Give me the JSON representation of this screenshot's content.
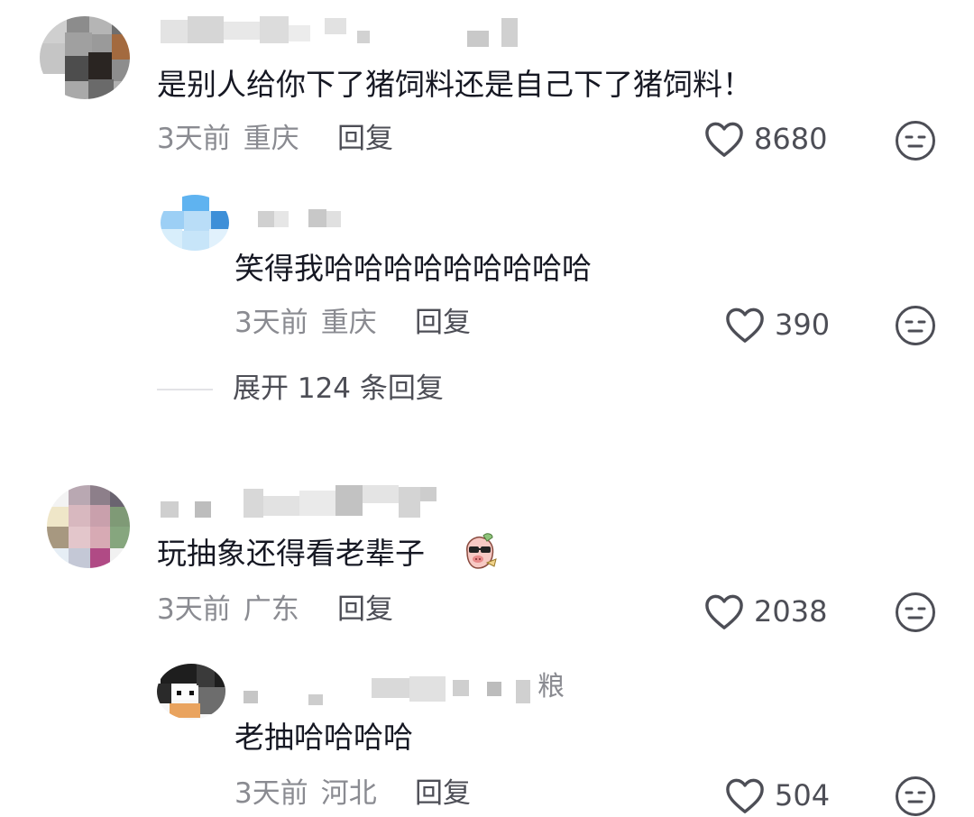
{
  "comments": [
    {
      "text": "是别人给你下了猪饲料还是自己下了猪饲料！",
      "time": "3天前",
      "location": "重庆",
      "reply_label": "回复",
      "likes": "8680",
      "replies": [
        {
          "text": "笑得我哈哈哈哈哈哈哈哈哈",
          "time": "3天前",
          "location": "重庆",
          "reply_label": "回复",
          "likes": "390"
        }
      ],
      "expand_label": "展开 124 条回复"
    },
    {
      "text": "玩抽象还得看老辈子",
      "time": "3天前",
      "location": "广东",
      "reply_label": "回复",
      "likes": "2038",
      "replies": [
        {
          "name_suffix": "粮",
          "text": "老抽哈哈哈哈",
          "time": "3天前",
          "location": "河北",
          "reply_label": "回复",
          "likes": "504"
        }
      ]
    }
  ],
  "icons": {
    "like": "heart-outline-icon",
    "dislike": "neutral-face-icon",
    "inline_emoji": "pig-sunglasses-emoji-icon"
  },
  "colors": {
    "text_primary": "#161823",
    "text_secondary": "#8a8b91",
    "action": "#4d4e56"
  }
}
